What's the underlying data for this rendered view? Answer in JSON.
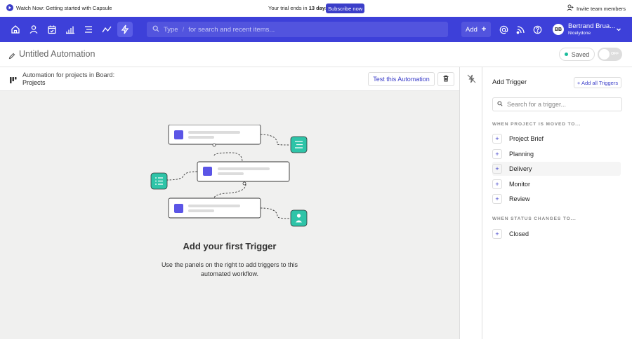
{
  "topbar": {
    "watch_label": "Watch Now: Getting started with Capsule",
    "trial_prefix": "Your trial ends in ",
    "trial_days": "13 days",
    "subscribe_label": "Subscribe now",
    "invite_label": "Invite team members"
  },
  "nav": {
    "icons": [
      "home-icon",
      "person-icon",
      "calendar-icon",
      "bar-chart-icon",
      "list-icon",
      "trend-icon",
      "automation-icon"
    ],
    "search_type_label": "Type",
    "search_sep": "/",
    "search_placeholder": "for search and recent items...",
    "add_label": "Add",
    "user_initials": "BB",
    "user_name": "Bertrand Brua...",
    "user_org": "Nicelydone"
  },
  "header": {
    "title": "Untitled Automation",
    "saved_label": "Saved",
    "toggle_label": "OFF"
  },
  "board": {
    "line1": "Automation for projects in Board:",
    "line2": "Projects",
    "test_label": "Test this Automation"
  },
  "empty_state": {
    "title": "Add your first Trigger",
    "description": "Use the panels on the right to add triggers to this automated workflow."
  },
  "triggers": {
    "title": "Add Trigger",
    "add_all_label": "+ Add all Triggers",
    "search_placeholder": "Search for a trigger...",
    "section1_label": "WHEN PROJECT IS MOVED TO...",
    "section1_items": [
      "Project Brief",
      "Planning",
      "Delivery",
      "Monitor",
      "Review"
    ],
    "section2_label": "WHEN STATUS CHANGES TO...",
    "section2_items": [
      "Closed"
    ]
  },
  "colors": {
    "nav_blue": "#3d40d9",
    "accent": "#3b3ec9",
    "teal": "#2ec4a8",
    "purple_square": "#5b55e6"
  }
}
